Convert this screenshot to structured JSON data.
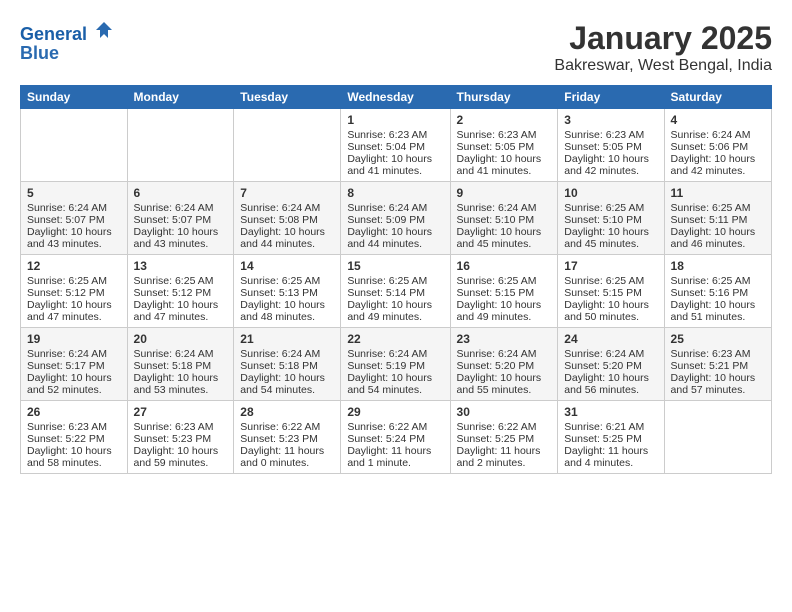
{
  "header": {
    "logo_line1": "General",
    "logo_line2": "Blue",
    "month": "January 2025",
    "location": "Bakreswar, West Bengal, India"
  },
  "days_of_week": [
    "Sunday",
    "Monday",
    "Tuesday",
    "Wednesday",
    "Thursday",
    "Friday",
    "Saturday"
  ],
  "weeks": [
    {
      "days": [
        {
          "num": "",
          "content": ""
        },
        {
          "num": "",
          "content": ""
        },
        {
          "num": "",
          "content": ""
        },
        {
          "num": "1",
          "content": "Sunrise: 6:23 AM\nSunset: 5:04 PM\nDaylight: 10 hours and 41 minutes."
        },
        {
          "num": "2",
          "content": "Sunrise: 6:23 AM\nSunset: 5:05 PM\nDaylight: 10 hours and 41 minutes."
        },
        {
          "num": "3",
          "content": "Sunrise: 6:23 AM\nSunset: 5:05 PM\nDaylight: 10 hours and 42 minutes."
        },
        {
          "num": "4",
          "content": "Sunrise: 6:24 AM\nSunset: 5:06 PM\nDaylight: 10 hours and 42 minutes."
        }
      ]
    },
    {
      "days": [
        {
          "num": "5",
          "content": "Sunrise: 6:24 AM\nSunset: 5:07 PM\nDaylight: 10 hours and 43 minutes."
        },
        {
          "num": "6",
          "content": "Sunrise: 6:24 AM\nSunset: 5:07 PM\nDaylight: 10 hours and 43 minutes."
        },
        {
          "num": "7",
          "content": "Sunrise: 6:24 AM\nSunset: 5:08 PM\nDaylight: 10 hours and 44 minutes."
        },
        {
          "num": "8",
          "content": "Sunrise: 6:24 AM\nSunset: 5:09 PM\nDaylight: 10 hours and 44 minutes."
        },
        {
          "num": "9",
          "content": "Sunrise: 6:24 AM\nSunset: 5:10 PM\nDaylight: 10 hours and 45 minutes."
        },
        {
          "num": "10",
          "content": "Sunrise: 6:25 AM\nSunset: 5:10 PM\nDaylight: 10 hours and 45 minutes."
        },
        {
          "num": "11",
          "content": "Sunrise: 6:25 AM\nSunset: 5:11 PM\nDaylight: 10 hours and 46 minutes."
        }
      ]
    },
    {
      "days": [
        {
          "num": "12",
          "content": "Sunrise: 6:25 AM\nSunset: 5:12 PM\nDaylight: 10 hours and 47 minutes."
        },
        {
          "num": "13",
          "content": "Sunrise: 6:25 AM\nSunset: 5:12 PM\nDaylight: 10 hours and 47 minutes."
        },
        {
          "num": "14",
          "content": "Sunrise: 6:25 AM\nSunset: 5:13 PM\nDaylight: 10 hours and 48 minutes."
        },
        {
          "num": "15",
          "content": "Sunrise: 6:25 AM\nSunset: 5:14 PM\nDaylight: 10 hours and 49 minutes."
        },
        {
          "num": "16",
          "content": "Sunrise: 6:25 AM\nSunset: 5:15 PM\nDaylight: 10 hours and 49 minutes."
        },
        {
          "num": "17",
          "content": "Sunrise: 6:25 AM\nSunset: 5:15 PM\nDaylight: 10 hours and 50 minutes."
        },
        {
          "num": "18",
          "content": "Sunrise: 6:25 AM\nSunset: 5:16 PM\nDaylight: 10 hours and 51 minutes."
        }
      ]
    },
    {
      "days": [
        {
          "num": "19",
          "content": "Sunrise: 6:24 AM\nSunset: 5:17 PM\nDaylight: 10 hours and 52 minutes."
        },
        {
          "num": "20",
          "content": "Sunrise: 6:24 AM\nSunset: 5:18 PM\nDaylight: 10 hours and 53 minutes."
        },
        {
          "num": "21",
          "content": "Sunrise: 6:24 AM\nSunset: 5:18 PM\nDaylight: 10 hours and 54 minutes."
        },
        {
          "num": "22",
          "content": "Sunrise: 6:24 AM\nSunset: 5:19 PM\nDaylight: 10 hours and 54 minutes."
        },
        {
          "num": "23",
          "content": "Sunrise: 6:24 AM\nSunset: 5:20 PM\nDaylight: 10 hours and 55 minutes."
        },
        {
          "num": "24",
          "content": "Sunrise: 6:24 AM\nSunset: 5:20 PM\nDaylight: 10 hours and 56 minutes."
        },
        {
          "num": "25",
          "content": "Sunrise: 6:23 AM\nSunset: 5:21 PM\nDaylight: 10 hours and 57 minutes."
        }
      ]
    },
    {
      "days": [
        {
          "num": "26",
          "content": "Sunrise: 6:23 AM\nSunset: 5:22 PM\nDaylight: 10 hours and 58 minutes."
        },
        {
          "num": "27",
          "content": "Sunrise: 6:23 AM\nSunset: 5:23 PM\nDaylight: 10 hours and 59 minutes."
        },
        {
          "num": "28",
          "content": "Sunrise: 6:22 AM\nSunset: 5:23 PM\nDaylight: 11 hours and 0 minutes."
        },
        {
          "num": "29",
          "content": "Sunrise: 6:22 AM\nSunset: 5:24 PM\nDaylight: 11 hours and 1 minute."
        },
        {
          "num": "30",
          "content": "Sunrise: 6:22 AM\nSunset: 5:25 PM\nDaylight: 11 hours and 2 minutes."
        },
        {
          "num": "31",
          "content": "Sunrise: 6:21 AM\nSunset: 5:25 PM\nDaylight: 11 hours and 4 minutes."
        },
        {
          "num": "",
          "content": ""
        }
      ]
    }
  ]
}
